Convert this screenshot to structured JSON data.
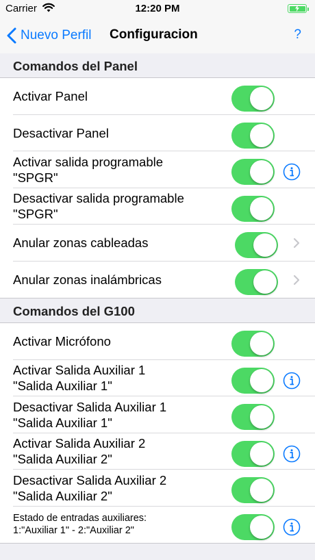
{
  "status_bar": {
    "carrier": "Carrier",
    "time": "12:20 PM",
    "wifi_icon": "wifi-icon",
    "battery_icon": "battery-charging-icon"
  },
  "nav": {
    "back_label": "Nuevo Perfil",
    "title": "Configuracion",
    "help_label": "?"
  },
  "colors": {
    "accent": "#0a7aff",
    "switch_on": "#4cd964",
    "background": "#efeff4"
  },
  "sections": [
    {
      "header": "Comandos del Panel",
      "rows": [
        {
          "label": "Activar Panel",
          "switch_on": true
        },
        {
          "label": "Desactivar Panel",
          "switch_on": true
        },
        {
          "label": "Activar salida programable\n\"SPGR\"",
          "switch_on": true,
          "accessory": "info-icon"
        },
        {
          "label": "Desactivar salida programable\n\"SPGR\"",
          "switch_on": true
        },
        {
          "label": "Anular zonas cableadas",
          "switch_on": true,
          "accessory": "chevron-right-icon"
        },
        {
          "label": "Anular zonas inalámbricas",
          "switch_on": true,
          "accessory": "chevron-right-icon"
        }
      ]
    },
    {
      "header": "Comandos del G100",
      "rows": [
        {
          "label": "Activar Micrófono",
          "switch_on": true
        },
        {
          "label": "Activar Salida Auxiliar 1\n\"Salida Auxiliar 1\"",
          "switch_on": true,
          "accessory": "info-icon"
        },
        {
          "label": "Desactivar Salida Auxiliar 1\n\"Salida Auxiliar 1\"",
          "switch_on": true
        },
        {
          "label": "Activar Salida Auxiliar 2\n\"Salida Auxiliar 2\"",
          "switch_on": true,
          "accessory": "info-icon"
        },
        {
          "label": "Desactivar Salida Auxiliar 2\n\"Salida Auxiliar 2\"",
          "switch_on": true
        },
        {
          "label": "Estado de entradas auxiliares:\n 1:\"Auxiliar 1\" - 2:\"Auxiliar 2\"",
          "switch_on": true,
          "accessory": "info-icon"
        }
      ]
    }
  ]
}
